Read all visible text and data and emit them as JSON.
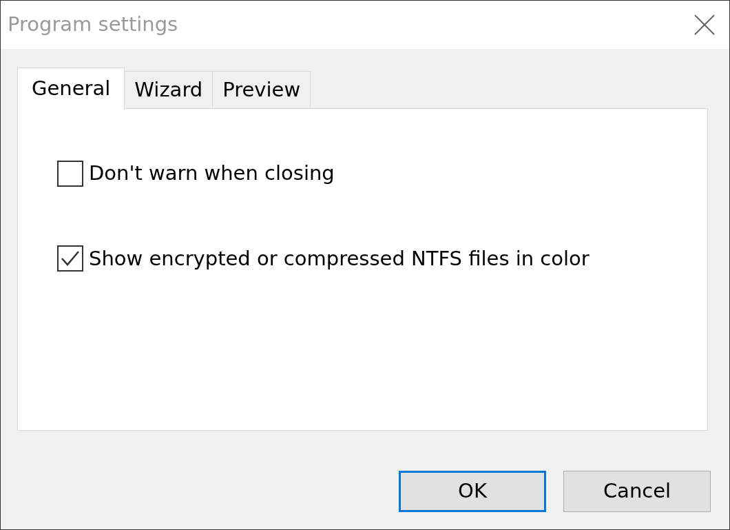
{
  "window": {
    "title": "Program settings"
  },
  "tabs": [
    {
      "label": "General",
      "selected": true
    },
    {
      "label": "Wizard",
      "selected": false
    },
    {
      "label": "Preview",
      "selected": false
    }
  ],
  "options": [
    {
      "label": "Don't warn when closing",
      "checked": false
    },
    {
      "label": "Show encrypted or compressed NTFS files in color",
      "checked": true
    }
  ],
  "buttons": [
    {
      "label": "OK",
      "default": true
    },
    {
      "label": "Cancel",
      "default": false
    }
  ]
}
